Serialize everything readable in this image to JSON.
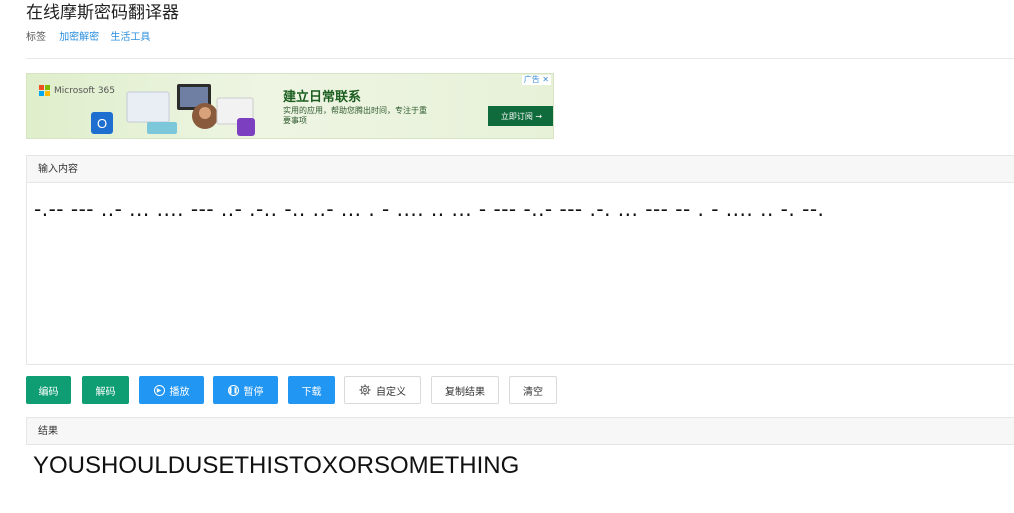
{
  "page": {
    "title": "在线摩斯密码翻译器",
    "tags_label": "标签",
    "tags": [
      "加密解密",
      "生活工具"
    ]
  },
  "ad": {
    "brand": "Microsoft 365",
    "headline": "建立日常联系",
    "subline": "实用的应用，帮助您腾出时间，专注于重要事项",
    "cta": "立即订阅 →",
    "ad_label": "广告 ✕"
  },
  "input": {
    "header": "输入内容",
    "value": "-.-- --- ..- ... .... --- ..- .-.. -.. ..- ... . - .... .. ... - --- -..- --- .-. ... --- -- . - .... .. -. --."
  },
  "buttons": {
    "encode": "编码",
    "decode": "解码",
    "play": "播放",
    "pause": "暂停",
    "download": "下载",
    "custom": "自定义",
    "copy": "复制结果",
    "clear": "清空"
  },
  "result": {
    "header": "结果",
    "value": "YOUSHOULDUSETHISTOXORSOMETHING"
  },
  "colors": {
    "green": "#0f9d74",
    "blue": "#2196f3",
    "link": "#2b8fde"
  }
}
